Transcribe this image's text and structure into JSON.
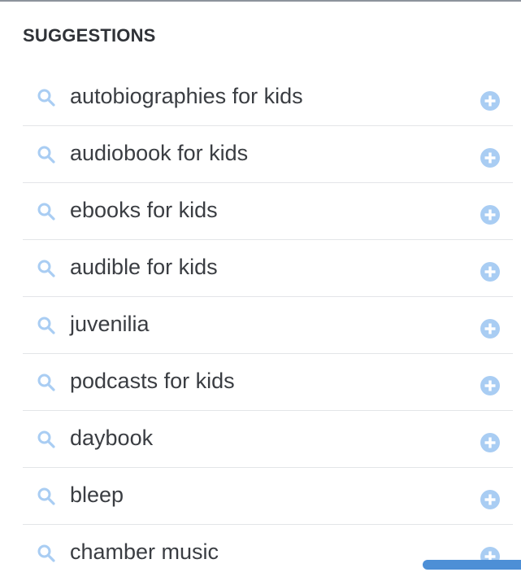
{
  "header": {
    "title": "SUGGESTIONS"
  },
  "suggestions": [
    {
      "label": "autobiographies for kids"
    },
    {
      "label": "audiobook for kids"
    },
    {
      "label": "ebooks for kids"
    },
    {
      "label": "audible for kids"
    },
    {
      "label": "juvenilia"
    },
    {
      "label": "podcasts for kids"
    },
    {
      "label": "daybook"
    },
    {
      "label": "bleep"
    },
    {
      "label": "chamber music"
    }
  ],
  "icons": {
    "search": "search-icon",
    "add": "plus-circle-icon"
  },
  "colors": {
    "icon_blue": "#a9cdf3",
    "text": "#3a3d42",
    "divider": "#e3e5e8",
    "top_border": "#8d939c"
  }
}
